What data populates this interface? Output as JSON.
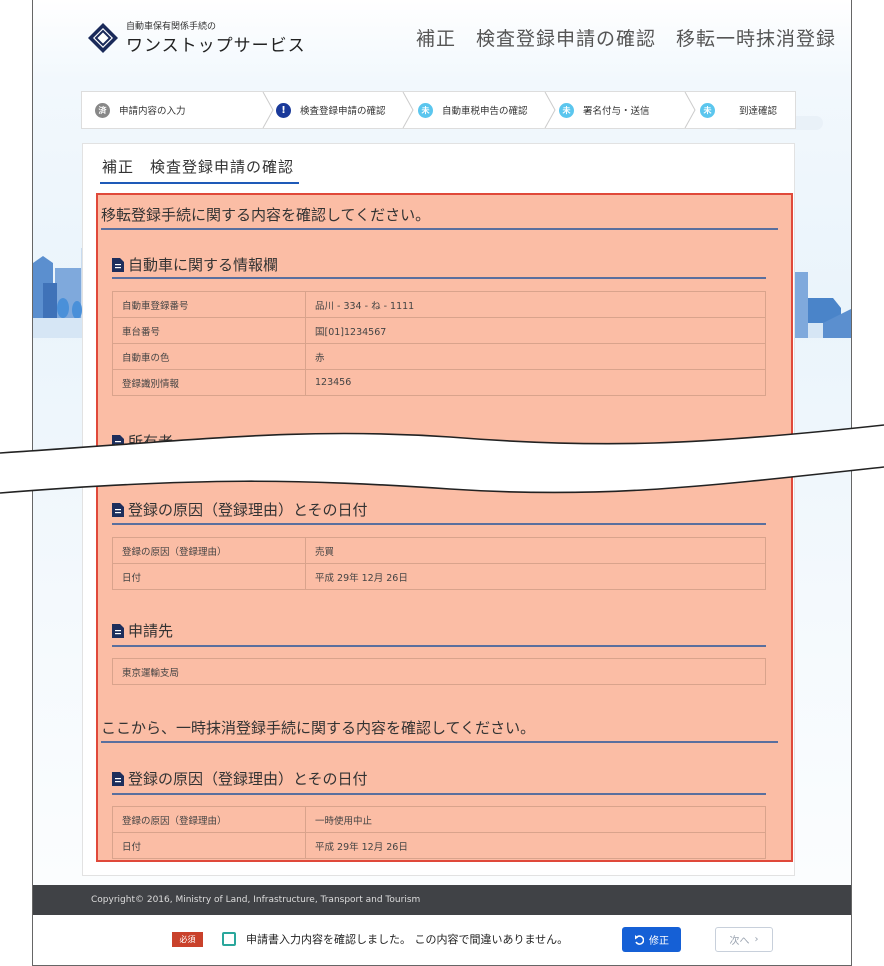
{
  "header": {
    "logo_small": "自動車保有関係手続の",
    "logo_main": "ワンストップサービス",
    "page_title": "補正　検査登録申請の確認　移転一時抹消登録"
  },
  "stepper": [
    {
      "badge": "済",
      "label": "申請内容の入力",
      "state": "done"
    },
    {
      "badge": "!",
      "label": "検査登録申請の確認",
      "state": "current"
    },
    {
      "badge": "未",
      "label": "自動車税申告の確認",
      "state": "todo"
    },
    {
      "badge": "未",
      "label": "署名付与・送信",
      "state": "todo"
    },
    {
      "badge": "未",
      "label": "到達確認",
      "state": "todo"
    }
  ],
  "panel": {
    "title": "補正　検査登録申請の確認",
    "transfer_intro": "移転登録手続に関する内容を確認してください。",
    "vehicle_heading": "自動車に関する情報欄",
    "vehicle_rows": [
      {
        "label": "自動車登録番号",
        "value": "品川 - 334 - ね - 1111"
      },
      {
        "label": "車台番号",
        "value": "国[01]1234567"
      },
      {
        "label": "自動車の色",
        "value": "赤"
      },
      {
        "label": "登録識別情報",
        "value": "123456"
      }
    ],
    "truncated_heading": "所有者",
    "reason_heading": "登録の原因（登録理由）とその日付",
    "reason_rows": [
      {
        "label": "登録の原因（登録理由）",
        "value": "売買"
      },
      {
        "label": "日付",
        "value": "平成 29年 12月 26日"
      }
    ],
    "office_heading": "申請先",
    "office_value": "東京運輸支局",
    "deregister_intro": "ここから、一時抹消登録手続に関する内容を確認してください。",
    "reason2_heading": "登録の原因（登録理由）とその日付",
    "reason2_rows": [
      {
        "label": "登録の原因（登録理由）",
        "value": "一時使用中止"
      },
      {
        "label": "日付",
        "value": "平成 29年 12月 26日"
      }
    ]
  },
  "footer": {
    "copyright": "Copyright© 2016, Ministry of Land, Infrastructure, Transport and Tourism",
    "required_badge": "必須",
    "confirm_label": "申請書入力内容を確認しました。 この内容で間違いありません。",
    "fix_button": "修正",
    "next_button": "次へ"
  },
  "colors": {
    "accent": "#1560d6",
    "highlight_border": "#e0493a",
    "highlight_fill": "#f8b89c",
    "required": "#c9412b",
    "checkbox": "#2aa79c",
    "todo_badge": "#5bc6ee",
    "current_badge": "#1a3a9a"
  }
}
